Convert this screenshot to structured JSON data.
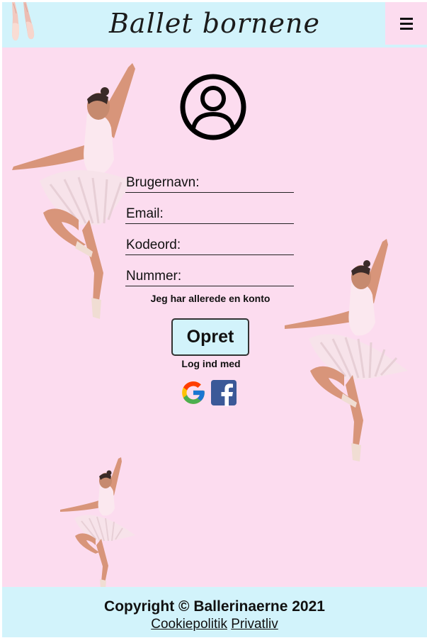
{
  "header": {
    "title": "Ballet bornene",
    "logo_icon": "ballet-slippers-icon",
    "menu_icon": "hamburger-menu-icon"
  },
  "form": {
    "avatar_icon": "user-circle-icon",
    "fields": [
      {
        "placeholder": "Brugernavn:",
        "type": "text"
      },
      {
        "placeholder": "Email:",
        "type": "email"
      },
      {
        "placeholder": "Kodeord:",
        "type": "password"
      },
      {
        "placeholder": "Nummer:",
        "type": "tel"
      }
    ],
    "already_account_link": "Jeg har allerede en konto",
    "submit_label": "Opret",
    "login_with_label": "Log ind med",
    "social": [
      {
        "name": "google-icon"
      },
      {
        "name": "facebook-icon"
      }
    ]
  },
  "footer": {
    "copyright": "Copyright © Ballerinaerne 2021",
    "links": [
      "Cookiepolitik",
      "Privatliv"
    ]
  },
  "colors": {
    "background": "#fcdcef",
    "header_footer": "#d2f3fb",
    "text": "#111111"
  }
}
